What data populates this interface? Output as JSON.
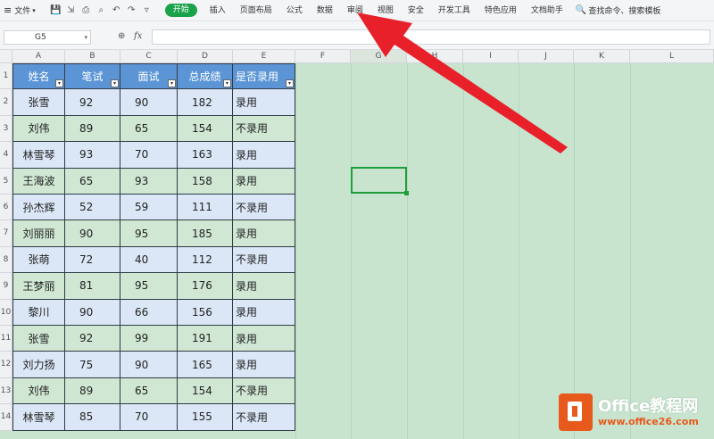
{
  "menubar": {
    "file_label": "文件",
    "tabs": [
      "开始",
      "插入",
      "页面布局",
      "公式",
      "数据",
      "审阅",
      "视图",
      "安全",
      "开发工具",
      "特色应用",
      "文档助手"
    ],
    "active_tab": "开始",
    "search_label": "查找命令、搜索模板"
  },
  "formulabar": {
    "name_box": "G5",
    "fx_label": "fx",
    "formula": ""
  },
  "grid": {
    "columns": [
      "A",
      "B",
      "C",
      "D",
      "E",
      "F",
      "G",
      "H",
      "I",
      "J",
      "K",
      "L"
    ],
    "rows": [
      "1",
      "2",
      "3",
      "4",
      "5",
      "6",
      "7",
      "8",
      "9",
      "10",
      "11",
      "12",
      "13",
      "14"
    ],
    "selected_column": "G",
    "selected_cell": "G5"
  },
  "table": {
    "headers": [
      "姓名",
      "笔试",
      "面试",
      "总成绩",
      "是否录用"
    ],
    "rows": [
      [
        "张雪",
        "92",
        "90",
        "182",
        "录用"
      ],
      [
        "刘伟",
        "89",
        "65",
        "154",
        "不录用"
      ],
      [
        "林雪琴",
        "93",
        "70",
        "163",
        "录用"
      ],
      [
        "王海波",
        "65",
        "93",
        "158",
        "录用"
      ],
      [
        "孙杰辉",
        "52",
        "59",
        "111",
        "不录用"
      ],
      [
        "刘丽丽",
        "90",
        "95",
        "185",
        "录用"
      ],
      [
        "张萌",
        "72",
        "40",
        "112",
        "不录用"
      ],
      [
        "王梦丽",
        "81",
        "95",
        "176",
        "录用"
      ],
      [
        "黎川",
        "90",
        "66",
        "156",
        "录用"
      ],
      [
        "张雪",
        "92",
        "99",
        "191",
        "录用"
      ],
      [
        "刘力扬",
        "75",
        "90",
        "165",
        "录用"
      ],
      [
        "刘伟",
        "89",
        "65",
        "154",
        "不录用"
      ],
      [
        "林雪琴",
        "85",
        "70",
        "155",
        "不录用"
      ]
    ]
  },
  "colors": {
    "header_blue": "#5b95d6",
    "row_blue": "#dbe7f6",
    "row_green": "#cfe7d3",
    "sheet_bg": "#c8e4cf",
    "arrow_red": "#e8202a",
    "active_tab": "#1aa24b"
  },
  "watermark": {
    "title": "Office教程网",
    "url": "www.office26.com"
  }
}
